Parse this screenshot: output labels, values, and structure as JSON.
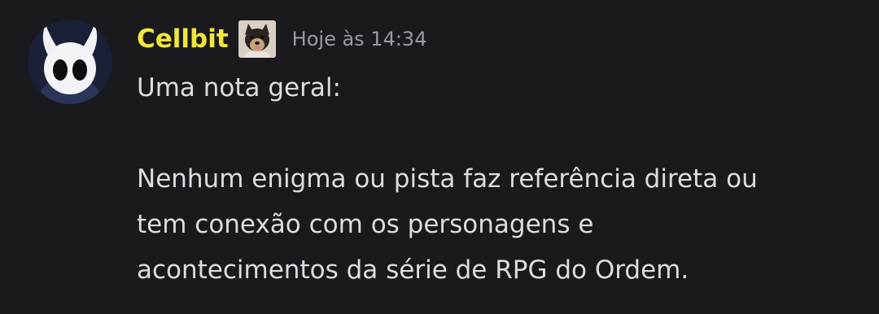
{
  "message": {
    "author": "Cellbit",
    "timestamp": "Hoje às 14:34",
    "avatar_icon": "hollow-knight-avatar",
    "role_icon": "dog-emoji-icon",
    "author_color": "#f2e63a",
    "text_lines": [
      "Uma nota geral:",
      "Nenhum enigma ou pista faz referência direta ou",
      "tem conexão com os personagens e",
      "acontecimentos da série de RPG do Ordem."
    ]
  }
}
